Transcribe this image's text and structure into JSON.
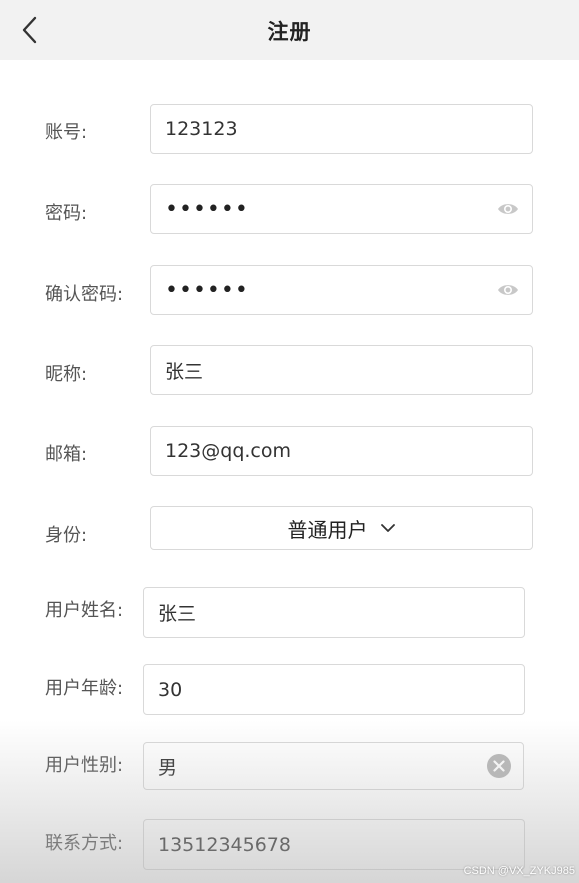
{
  "header": {
    "title": "注册"
  },
  "form": {
    "account": {
      "label": "账号:",
      "value": "123123"
    },
    "password": {
      "label": "密码:",
      "value": "••••••"
    },
    "confirm_password": {
      "label": "确认密码:",
      "value": "••••••"
    },
    "nickname": {
      "label": "昵称:",
      "value": "张三"
    },
    "email": {
      "label": "邮箱:",
      "value": "123@qq.com"
    },
    "identity": {
      "label": "身份:",
      "value": "普通用户"
    },
    "user_name": {
      "label": "用户姓名:",
      "value": "张三"
    },
    "user_age": {
      "label": "用户年龄:",
      "value": "30"
    },
    "user_gender": {
      "label": "用户性别:",
      "value": "男"
    },
    "contact": {
      "label": "联系方式:",
      "value": "13512345678"
    }
  },
  "watermark": "CSDN @VX_ZYKJ985",
  "icons": {
    "back": "chevron-left-icon",
    "password_toggle": "eye-icon",
    "select_arrow": "chevron-down-icon",
    "clear": "clear-circle-icon"
  }
}
